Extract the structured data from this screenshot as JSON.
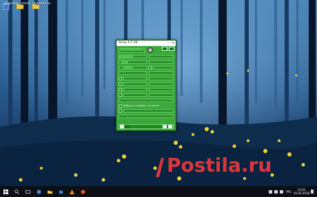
{
  "desktop": {
    "icons": [
      {
        "name": "recycle-bin",
        "label": "Корзина"
      },
      {
        "name": "folder-1",
        "label": "Папка"
      },
      {
        "name": "folder-2",
        "label": "Документы"
      }
    ]
  },
  "aimp": {
    "title": "Aimp 4.5 VK",
    "rows": [
      {
        "label": ""
      },
      {
        "label": ""
      },
      {
        "label": ""
      },
      {
        "label": ""
      },
      {
        "label": ""
      },
      {
        "label": ""
      },
      {
        "label": ""
      },
      {
        "label": ""
      },
      {
        "label": "Выбрать плейлист по папке"
      },
      {
        "label": ""
      }
    ]
  },
  "taskbar": {
    "time": "12:41",
    "date": "05.03.2018",
    "lang": "РУС"
  },
  "colors": {
    "window_green": "#3aa93a",
    "taskbar": "#0d0f14"
  }
}
